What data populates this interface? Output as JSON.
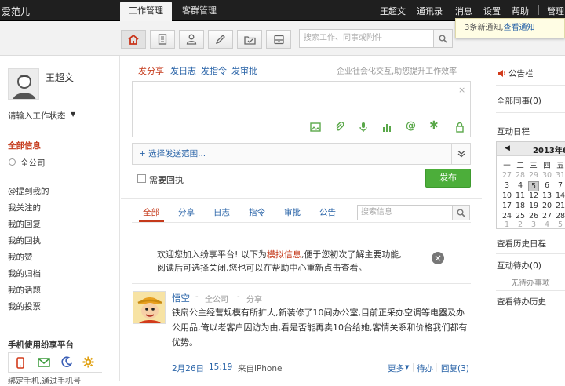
{
  "topbar": {
    "brand": "爱范儿",
    "tabs": [
      "工作管理",
      "客群管理"
    ],
    "user": "王超文",
    "links": [
      "通讯录",
      "消息",
      "设置",
      "帮助"
    ],
    "admin": "管理"
  },
  "search": {
    "placeholder": "搜索工作、同事或附件"
  },
  "notice": {
    "count_text": "3条新通知,",
    "link": "查看通知"
  },
  "left": {
    "name": "王超文",
    "status": "请输入工作状态",
    "all_info": "全部信息",
    "company": "全公司",
    "links": [
      "@提到我的",
      "我关注的",
      "我的回复",
      "我的回执",
      "我的赞",
      "我的归档",
      "我的话题",
      "我的投票"
    ],
    "mobile_title": "手机使用纷享平台",
    "bottom_text": "绑定手机,通过手机号"
  },
  "composer": {
    "tabs": [
      "发分享",
      "发日志",
      "发指令",
      "发审批"
    ],
    "slogan": "企业社会化交互,助您提升工作效率",
    "scope": "+ 选择发送范围...",
    "need_receipt": "需要回执",
    "publish": "发布"
  },
  "feed": {
    "tabs": [
      "全部",
      "分享",
      "日志",
      "指令",
      "审批",
      "公告"
    ],
    "search_placeholder": "搜索信息",
    "welcome": {
      "p1": "欢迎您加入纷享平台! 以下为",
      "link": "模拟信息",
      "p2": ",便于您初次了解主要功能,",
      "line2": "阅读后可选择关闭,您也可以在帮助中心重新点击查看。"
    },
    "post": {
      "author": "悟空",
      "scope": "全公司",
      "type": "分享",
      "sep": "-",
      "text": "铁扇公主经营规模有所扩大,新装修了10间办公室,目前正采办空调等电器及办公用品,俺以老客户因访为由,看是否能再卖10台给她,客情关系和价格我们都有优势。",
      "date": "2月26日",
      "time": "15:19",
      "source": "来自iPhone",
      "more": "更多",
      "pending": "待办",
      "reply": "回复(3)"
    }
  },
  "right": {
    "notice_title": "公告栏",
    "all_colleagues": "全部同事(0)",
    "schedule_title": "互动日程",
    "cal_month": "2013年6月",
    "cal_weekdays": [
      "一",
      "二",
      "三",
      "四",
      "五"
    ],
    "cal_rows": [
      [
        "27",
        "28",
        "29",
        "30",
        "31"
      ],
      [
        "3",
        "4",
        "5",
        "6",
        "7"
      ],
      [
        "10",
        "11",
        "12",
        "13",
        "14"
      ],
      [
        "17",
        "18",
        "19",
        "20",
        "21"
      ],
      [
        "24",
        "25",
        "26",
        "27",
        "28"
      ],
      [
        "1",
        "2",
        "3",
        "4",
        "5"
      ]
    ],
    "history_schedule": "查看历史日程",
    "todo_title": "互动待办(0)",
    "no_todo": "无待办事项",
    "history_todo": "查看待办历史"
  }
}
